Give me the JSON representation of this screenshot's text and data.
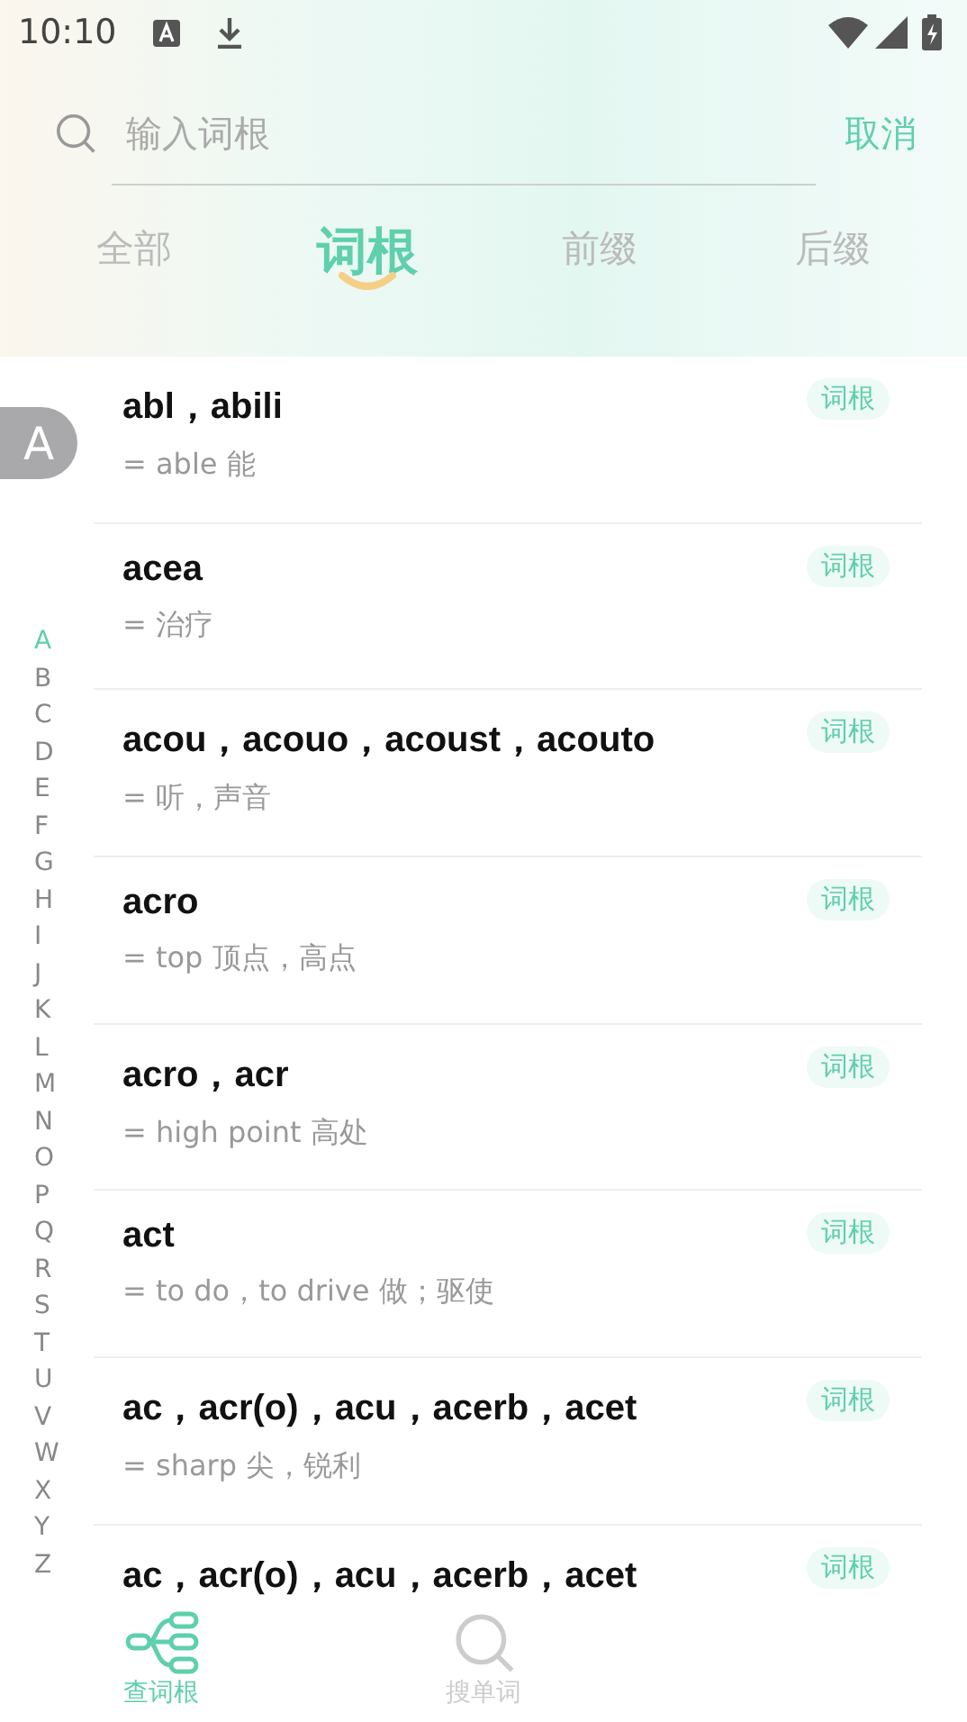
{
  "status_bar": {
    "time": "10:10"
  },
  "search": {
    "placeholder": "输入词根",
    "cancel": "取消"
  },
  "tabs": [
    {
      "label": "全部",
      "selected": false
    },
    {
      "label": "词根",
      "selected": true
    },
    {
      "label": "前缀",
      "selected": false
    },
    {
      "label": "后缀",
      "selected": false
    }
  ],
  "current_letter": "A",
  "index": [
    {
      "letter": "A",
      "selected": true
    },
    {
      "letter": "B",
      "selected": false
    },
    {
      "letter": "C",
      "selected": false
    },
    {
      "letter": "D",
      "selected": false
    },
    {
      "letter": "E",
      "selected": false
    },
    {
      "letter": "F",
      "selected": false
    },
    {
      "letter": "G",
      "selected": false
    },
    {
      "letter": "H",
      "selected": false
    },
    {
      "letter": "I",
      "selected": false
    },
    {
      "letter": "J",
      "selected": false
    },
    {
      "letter": "K",
      "selected": false
    },
    {
      "letter": "L",
      "selected": false
    },
    {
      "letter": "M",
      "selected": false
    },
    {
      "letter": "N",
      "selected": false
    },
    {
      "letter": "O",
      "selected": false
    },
    {
      "letter": "P",
      "selected": false
    },
    {
      "letter": "Q",
      "selected": false
    },
    {
      "letter": "R",
      "selected": false
    },
    {
      "letter": "S",
      "selected": false
    },
    {
      "letter": "T",
      "selected": false
    },
    {
      "letter": "U",
      "selected": false
    },
    {
      "letter": "V",
      "selected": false
    },
    {
      "letter": "W",
      "selected": false
    },
    {
      "letter": "X",
      "selected": false
    },
    {
      "letter": "Y",
      "selected": false
    },
    {
      "letter": "Z",
      "selected": false
    }
  ],
  "entries": [
    {
      "title": "abl，abili",
      "meaning": "= able 能",
      "tag": "词根"
    },
    {
      "title": "acea",
      "meaning": "= 治疗",
      "tag": "词根"
    },
    {
      "title": "acou，acouo，acoust，acouto",
      "meaning": "= 听，声音",
      "tag": "词根"
    },
    {
      "title": "acro",
      "meaning": "= top 顶点，高点",
      "tag": "词根"
    },
    {
      "title": "acro，acr",
      "meaning": "= high point 高处",
      "tag": "词根"
    },
    {
      "title": "act",
      "meaning": "= to do，to drive 做；驱使",
      "tag": "词根"
    },
    {
      "title": "ac，acr(o)，acu，acerb，acet",
      "meaning": "= sharp 尖，锐利",
      "tag": "词根"
    },
    {
      "title": "ac，acr(o)，acu，acerb，acet",
      "tag": "词根"
    }
  ],
  "bottom_nav": [
    {
      "label": "查词根",
      "kind": "tree",
      "selected": true
    },
    {
      "label": "搜单词",
      "kind": "search",
      "selected": false
    }
  ]
}
